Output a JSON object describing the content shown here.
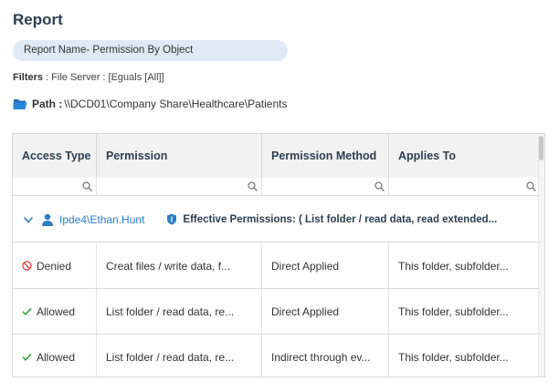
{
  "page": {
    "title": "Report",
    "report_name": "Report Name- Permission By Object",
    "filters_label": "Filters",
    "filters_value": " : File Server : [Eguals [All]]",
    "path_label": "Path :",
    "path_value": "\\\\DCD01\\Company Share\\Healthcare\\Patients"
  },
  "table": {
    "columns": [
      "Access Type",
      "Permission",
      "Permission Method",
      "Applies To"
    ],
    "group": {
      "user": "Ipde4\\Ethan.Hunt",
      "effective": "Effective Permissions: ( List folder / read data, read extended..."
    },
    "rows": [
      {
        "access": "Denied",
        "permission": "Creat files / write data, f...",
        "method": "Direct Applied",
        "applies": "This folder, subfolder..."
      },
      {
        "access": "Allowed",
        "permission": "List folder / read data, re...",
        "method": "Direct Applied",
        "applies": "This folder, subfolder..."
      },
      {
        "access": "Allowed",
        "permission": "List folder / read data, re...",
        "method": "Indirect through ev...",
        "applies": "This folder, subfolder..."
      }
    ]
  },
  "colors": {
    "accent": "#2a7ec8",
    "denied": "#d9322e",
    "allowed": "#2e9e3e",
    "pill": "#dfeaf6"
  },
  "icons": [
    "folder-icon",
    "search-icon",
    "chevron-down-icon",
    "user-icon",
    "shield-icon",
    "denied-icon",
    "check-icon"
  ]
}
